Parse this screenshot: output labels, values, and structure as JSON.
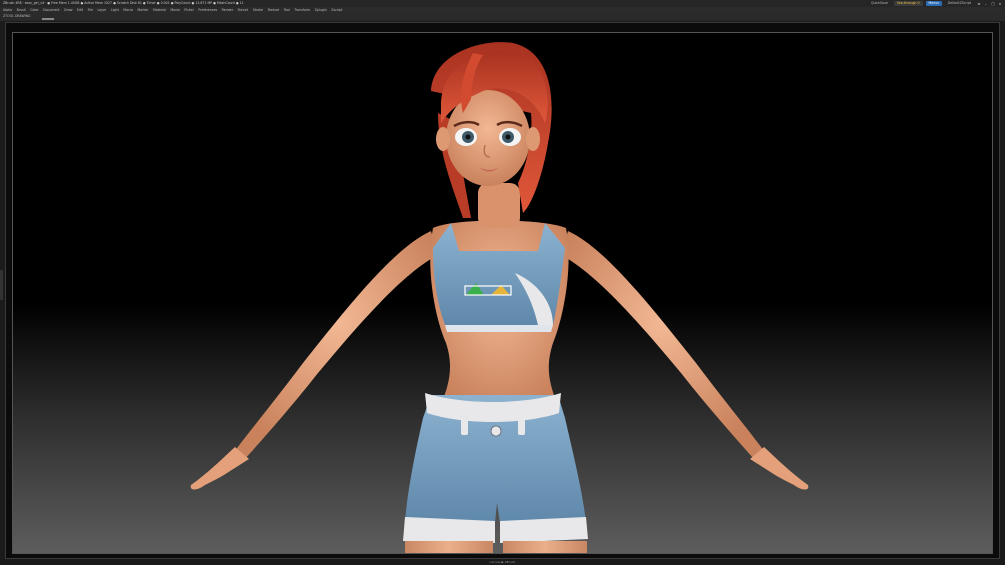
{
  "window": {
    "title": "ZBrush 4R8  ·  sexy_girl_v4  ·  ● Free Mem 1.45GB  ● Active Mem 1027  ● Scratch Disk 61  ● Timer ● 0.001  ● PolyCount ● 13.671 MP  ● MeshCount ● 11"
  },
  "topright": {
    "quicksave_label": "QuickSave",
    "seethrough_label": "See-through  0",
    "menus_label": "Menus",
    "defaultscript_label": "DefaultZScript"
  },
  "menubar": {
    "items": [
      "Alpha",
      "Brush",
      "Color",
      "Document",
      "Draw",
      "Edit",
      "File",
      "Layer",
      "Light",
      "Macro",
      "Marker",
      "Material",
      "Movie",
      "Picker",
      "Preferences",
      "Render",
      "Stencil",
      "Stroke",
      "Texture",
      "Tool",
      "Transform",
      "Zplugin",
      "Zscript"
    ]
  },
  "subbar": {
    "label": "ZTOOL DRAWING"
  },
  "status": {
    "text": "Canvas ▶ ZBrush"
  },
  "colors": {
    "skin": "#e8a47e",
    "hair": "#c9482e",
    "clothing": "#7fa6c6",
    "trim": "#e8e8ea",
    "accent_blue": "#2b6cb3"
  },
  "icons": [
    "minimize-icon",
    "restore-icon",
    "close-icon",
    "menu-toggle-icon"
  ]
}
